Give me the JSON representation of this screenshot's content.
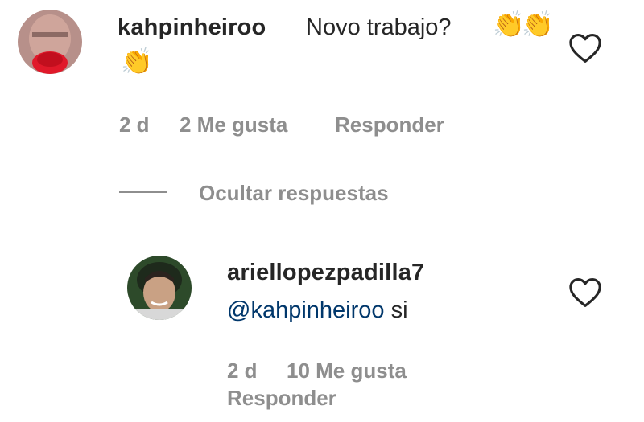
{
  "comment": {
    "username": "kahpinheiroo",
    "text": "Novo trabajo?",
    "emoji": [
      "clapping-hands",
      "clapping-hands",
      "clapping-hands"
    ],
    "time": "2 d",
    "likes": "2 Me gusta",
    "reply_label": "Responder"
  },
  "thread": {
    "hide_replies_label": "Ocultar respuestas"
  },
  "reply": {
    "username": "ariellopezpadilla7",
    "mention": "@kahpinheiroo",
    "text": "si",
    "time": "2 d",
    "likes": "10 Me gusta",
    "reply_label": "Responder"
  },
  "colors": {
    "text": "#262626",
    "meta": "#8e8e8e",
    "mention": "#00376b",
    "background": "#ffffff"
  }
}
